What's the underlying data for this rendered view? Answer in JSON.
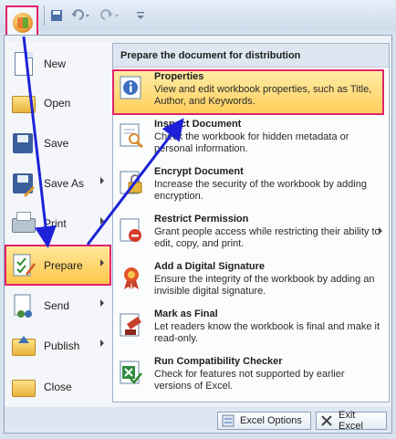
{
  "qat": {
    "save_icon": "save-icon",
    "undo_icon": "undo-icon",
    "redo_icon": "redo-icon",
    "customize_icon": "customize-qat-icon"
  },
  "left_menu": {
    "items": [
      {
        "label": "New",
        "icon": "new-doc-icon"
      },
      {
        "label": "Open",
        "icon": "open-folder-icon"
      },
      {
        "label": "Save",
        "icon": "save-icon"
      },
      {
        "label": "Save As",
        "icon": "save-as-icon"
      },
      {
        "label": "Print",
        "icon": "print-icon"
      },
      {
        "label": "Prepare",
        "icon": "prepare-icon"
      },
      {
        "label": "Send",
        "icon": "send-icon"
      },
      {
        "label": "Publish",
        "icon": "publish-icon"
      },
      {
        "label": "Close",
        "icon": "close-folder-icon"
      }
    ]
  },
  "submenu": {
    "header": "Prepare the document for distribution",
    "items": [
      {
        "title": "Properties",
        "desc": "View and edit workbook properties, such as Title, Author, and Keywords."
      },
      {
        "title": "Inspect Document",
        "desc": "Check the workbook for hidden metadata or personal information."
      },
      {
        "title": "Encrypt Document",
        "desc": "Increase the security of the workbook by adding encryption."
      },
      {
        "title": "Restrict Permission",
        "desc": "Grant people access while restricting their ability to edit, copy, and print."
      },
      {
        "title": "Add a Digital Signature",
        "desc": "Ensure the integrity of the workbook by adding an invisible digital signature."
      },
      {
        "title": "Mark as Final",
        "desc": "Let readers know the workbook is final and make it read-only."
      },
      {
        "title": "Run Compatibility Checker",
        "desc": "Check for features not supported by earlier versions of Excel."
      }
    ]
  },
  "footer": {
    "options_label": "Excel Options",
    "exit_label": "Exit Excel"
  },
  "colors": {
    "highlight_border": "#e2236b",
    "arrow": "#1d22d8"
  }
}
